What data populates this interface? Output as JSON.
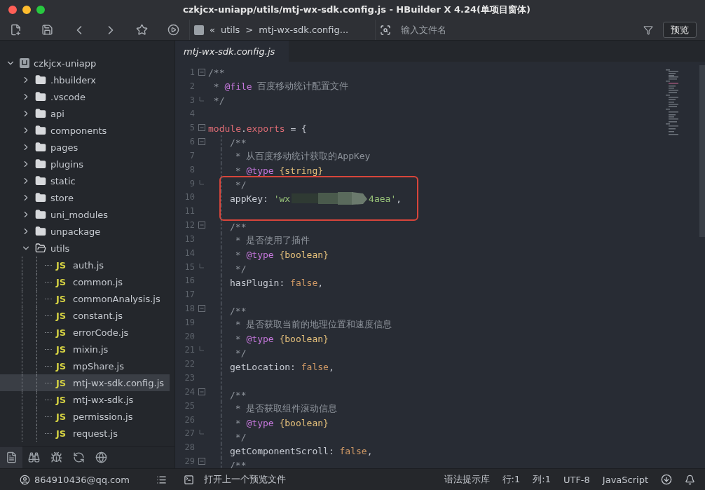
{
  "window": {
    "title": "czkjcx-uniapp/utils/mtj-wx-sdk.config.js - HBuilder X 4.24(单项目窗体)"
  },
  "toolbar": {
    "breadcrumb": [
      "«",
      "utils",
      ">",
      "mtj-wx-sdk.config..."
    ],
    "search": {
      "placeholder": "输入文件名"
    },
    "preview_button": "预览"
  },
  "tabs": [
    {
      "label": "mtj-wx-sdk.config.js",
      "selected": true
    }
  ],
  "tree": [
    {
      "label": "czkjcx-uniapp",
      "kind": "project",
      "expanded": true,
      "selected": false,
      "children": [
        {
          "label": ".hbuilderx",
          "kind": "folder",
          "expanded": false,
          "selected": false
        },
        {
          "label": ".vscode",
          "kind": "folder",
          "expanded": false,
          "selected": false
        },
        {
          "label": "api",
          "kind": "folder",
          "expanded": false,
          "selected": false
        },
        {
          "label": "components",
          "kind": "folder",
          "expanded": false,
          "selected": false
        },
        {
          "label": "pages",
          "kind": "folder",
          "expanded": false,
          "selected": false
        },
        {
          "label": "plugins",
          "kind": "folder",
          "expanded": false,
          "selected": false
        },
        {
          "label": "static",
          "kind": "folder",
          "expanded": false,
          "selected": false
        },
        {
          "label": "store",
          "kind": "folder",
          "expanded": false,
          "selected": false
        },
        {
          "label": "uni_modules",
          "kind": "folder",
          "expanded": false,
          "selected": false
        },
        {
          "label": "unpackage",
          "kind": "folder",
          "expanded": false,
          "selected": false
        },
        {
          "label": "utils",
          "kind": "folder",
          "expanded": true,
          "selected": false,
          "children": [
            {
              "label": "auth.js",
              "kind": "js",
              "icon_text": "JS",
              "selected": false
            },
            {
              "label": "common.js",
              "kind": "js",
              "icon_text": "JS",
              "selected": false
            },
            {
              "label": "commonAnalysis.js",
              "kind": "js",
              "icon_text": "JS",
              "selected": false
            },
            {
              "label": "constant.js",
              "kind": "js",
              "icon_text": "JS",
              "selected": false
            },
            {
              "label": "errorCode.js",
              "kind": "js",
              "icon_text": "JS",
              "selected": false
            },
            {
              "label": "mixin.js",
              "kind": "js",
              "icon_text": "JS",
              "selected": false
            },
            {
              "label": "mpShare.js",
              "kind": "js",
              "icon_text": "JS",
              "selected": false
            },
            {
              "label": "mtj-wx-sdk.config.js",
              "kind": "js",
              "icon_text": "JS",
              "selected": true
            },
            {
              "label": "mtj-wx-sdk.js",
              "kind": "js",
              "icon_text": "JS",
              "selected": false
            },
            {
              "label": "permission.js",
              "kind": "js",
              "icon_text": "JS",
              "selected": false
            },
            {
              "label": "request.js",
              "kind": "js",
              "icon_text": "JS",
              "selected": false
            }
          ]
        }
      ]
    }
  ],
  "sidebar_tools": [
    {
      "kind": "files",
      "selected": true
    },
    {
      "kind": "find",
      "selected": false
    },
    {
      "kind": "debug",
      "selected": false
    },
    {
      "kind": "sync",
      "selected": false
    },
    {
      "kind": "web",
      "selected": false
    }
  ],
  "code": [
    {
      "n": "1",
      "kind": "foldstart",
      "boxed": false,
      "tokens": [
        {
          "t": "/**",
          "kind": "comment"
        }
      ]
    },
    {
      "n": "2",
      "kind": "line",
      "boxed": false,
      "tokens": [
        {
          "t": " * ",
          "kind": "comment"
        },
        {
          "t": "@file",
          "kind": "tag"
        },
        {
          "t": " 百度移动统计配置文件",
          "kind": "comment"
        }
      ]
    },
    {
      "n": "3",
      "kind": "foldend",
      "boxed": false,
      "tokens": [
        {
          "t": " */",
          "kind": "comment"
        }
      ]
    },
    {
      "n": "4",
      "kind": "line",
      "boxed": false
    },
    {
      "n": "5",
      "kind": "foldstart",
      "boxed": false,
      "tokens": [
        {
          "t": "module",
          "kind": "module"
        },
        {
          "t": ".",
          "kind": "plain"
        },
        {
          "t": "exports",
          "kind": "module"
        },
        {
          "t": " = {",
          "kind": "plain"
        }
      ],
      "children": [
        {
          "n": "6",
          "kind": "foldstart",
          "boxed": false,
          "tokens": [
            {
              "t": "/**",
              "kind": "comment"
            }
          ]
        },
        {
          "n": "7",
          "kind": "line",
          "boxed": false,
          "tokens": [
            {
              "t": " * 从百度移动统计获取的AppKey",
              "kind": "comment"
            }
          ]
        },
        {
          "n": "8",
          "kind": "line",
          "boxed": false,
          "tokens": [
            {
              "t": " * ",
              "kind": "comment"
            },
            {
              "t": "@type",
              "kind": "tag"
            },
            {
              "t": " {string}",
              "kind": "type"
            }
          ]
        },
        {
          "n": "9",
          "kind": "foldend",
          "boxed": true,
          "tokens": [
            {
              "t": " */",
              "kind": "comment"
            }
          ]
        },
        {
          "n": "10",
          "kind": "line",
          "boxed": true,
          "tokens": [
            {
              "t": "appKey",
              "kind": "prop"
            },
            {
              "t": ": ",
              "kind": "plain"
            },
            {
              "t": "'wx",
              "kind": "string"
            },
            {
              "kind": "redacted"
            },
            {
              "t": "4aea'",
              "kind": "string"
            },
            {
              "t": ",",
              "kind": "plain"
            }
          ]
        },
        {
          "n": "11",
          "kind": "line",
          "boxed": true
        },
        {
          "n": "12",
          "kind": "foldstart",
          "boxed": false,
          "tokens": [
            {
              "t": "/**",
              "kind": "comment"
            }
          ]
        },
        {
          "n": "13",
          "kind": "line",
          "boxed": false,
          "tokens": [
            {
              "t": " * 是否使用了插件",
              "kind": "comment"
            }
          ]
        },
        {
          "n": "14",
          "kind": "line",
          "boxed": false,
          "tokens": [
            {
              "t": " * ",
              "kind": "comment"
            },
            {
              "t": "@type",
              "kind": "tag"
            },
            {
              "t": " {boolean}",
              "kind": "type"
            }
          ]
        },
        {
          "n": "15",
          "kind": "foldend",
          "boxed": false,
          "tokens": [
            {
              "t": " */",
              "kind": "comment"
            }
          ]
        },
        {
          "n": "16",
          "kind": "line",
          "boxed": false,
          "tokens": [
            {
              "t": "hasPlugin",
              "kind": "prop"
            },
            {
              "t": ": ",
              "kind": "plain"
            },
            {
              "t": "false",
              "kind": "bool"
            },
            {
              "t": ",",
              "kind": "plain"
            }
          ]
        },
        {
          "n": "17",
          "kind": "line",
          "boxed": false
        },
        {
          "n": "18",
          "kind": "foldstart",
          "boxed": false,
          "tokens": [
            {
              "t": "/**",
              "kind": "comment"
            }
          ]
        },
        {
          "n": "19",
          "kind": "line",
          "boxed": false,
          "tokens": [
            {
              "t": " * 是否获取当前的地理位置和速度信息",
              "kind": "comment"
            }
          ]
        },
        {
          "n": "20",
          "kind": "line",
          "boxed": false,
          "tokens": [
            {
              "t": " * ",
              "kind": "comment"
            },
            {
              "t": "@type",
              "kind": "tag"
            },
            {
              "t": " {boolean}",
              "kind": "type"
            }
          ]
        },
        {
          "n": "21",
          "kind": "foldend",
          "boxed": false,
          "tokens": [
            {
              "t": " */",
              "kind": "comment"
            }
          ]
        },
        {
          "n": "22",
          "kind": "line",
          "boxed": false,
          "tokens": [
            {
              "t": "getLocation",
              "kind": "prop"
            },
            {
              "t": ": ",
              "kind": "plain"
            },
            {
              "t": "false",
              "kind": "bool"
            },
            {
              "t": ",",
              "kind": "plain"
            }
          ]
        },
        {
          "n": "23",
          "kind": "line",
          "boxed": false
        },
        {
          "n": "24",
          "kind": "foldstart",
          "boxed": false,
          "tokens": [
            {
              "t": "/**",
              "kind": "comment"
            }
          ]
        },
        {
          "n": "25",
          "kind": "line",
          "boxed": false,
          "tokens": [
            {
              "t": " * 是否获取组件滚动信息",
              "kind": "comment"
            }
          ]
        },
        {
          "n": "26",
          "kind": "line",
          "boxed": false,
          "tokens": [
            {
              "t": " * ",
              "kind": "comment"
            },
            {
              "t": "@type",
              "kind": "tag"
            },
            {
              "t": " {boolean}",
              "kind": "type"
            }
          ]
        },
        {
          "n": "27",
          "kind": "foldend",
          "boxed": false,
          "tokens": [
            {
              "t": " */",
              "kind": "comment"
            }
          ]
        },
        {
          "n": "28",
          "kind": "line",
          "boxed": false,
          "tokens": [
            {
              "t": "getComponentScroll",
              "kind": "prop"
            },
            {
              "t": ": ",
              "kind": "plain"
            },
            {
              "t": "false",
              "kind": "bool"
            },
            {
              "t": ",",
              "kind": "plain"
            }
          ]
        },
        {
          "n": "29",
          "kind": "foldstart",
          "boxed": false,
          "tokens": [
            {
              "t": "/**",
              "kind": "comment"
            }
          ]
        }
      ]
    }
  ],
  "status_bar": {
    "account": "864910436@qq.com",
    "message": "打开上一个预览文件",
    "items": [
      "语法提示库",
      "行:1",
      "列:1",
      "UTF-8",
      "JavaScript"
    ]
  }
}
